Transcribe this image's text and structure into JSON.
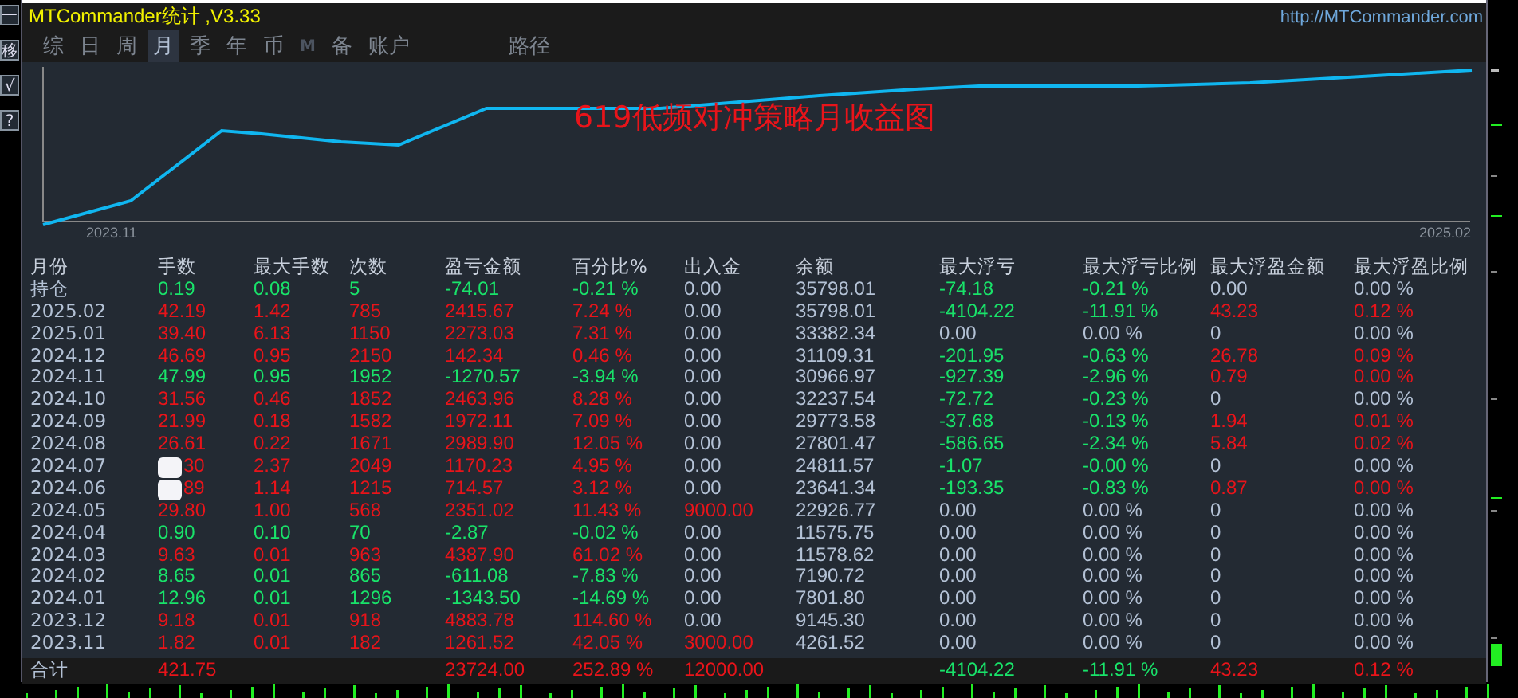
{
  "side_buttons": [
    "一",
    "移",
    "√",
    "?"
  ],
  "panel": {
    "title": "MTCommander统计 ,V3.33",
    "url": "http://MTCommander.com"
  },
  "tabs": [
    {
      "label": "综",
      "selected": false,
      "disabled": false
    },
    {
      "label": "日",
      "selected": false,
      "disabled": false
    },
    {
      "label": "周",
      "selected": false,
      "disabled": false
    },
    {
      "label": "月",
      "selected": true,
      "disabled": false
    },
    {
      "label": "季",
      "selected": false,
      "disabled": false
    },
    {
      "label": "年",
      "selected": false,
      "disabled": false
    },
    {
      "label": "币",
      "selected": false,
      "disabled": false
    },
    {
      "label": "M",
      "selected": false,
      "disabled": true
    },
    {
      "label": "备",
      "selected": false,
      "disabled": false
    },
    {
      "label": "账户",
      "selected": false,
      "disabled": false
    }
  ],
  "path_tab": {
    "label": "路径"
  },
  "chart": {
    "title": "619低频对冲策略月收益图",
    "x_start_label": "2023.11",
    "x_end_label": "2025.02"
  },
  "table": {
    "columns": [
      "月份",
      "手数",
      "最大手数",
      "次数",
      "盈亏金额",
      "百分比%",
      "出入金",
      "余额",
      "最大浮亏",
      "最大浮亏比例",
      "最大浮盈金额",
      "最大浮盈比例"
    ],
    "rows": [
      {
        "cells": [
          {
            "text": "持仓",
            "color": "#b4c2d6"
          },
          {
            "text": "0.19",
            "color": "#19e36a"
          },
          {
            "text": "0.08",
            "color": "#19e36a"
          },
          {
            "text": "5",
            "color": "#19e36a"
          },
          {
            "text": "-74.01",
            "color": "#19e36a"
          },
          {
            "text": "-0.21 %",
            "color": "#19e36a"
          },
          {
            "text": "0.00",
            "color": "#b4c2d6"
          },
          {
            "text": "35798.01",
            "color": "#b4c2d6"
          },
          {
            "text": "-74.18",
            "color": "#19e36a"
          },
          {
            "text": "-0.21 %",
            "color": "#19e36a"
          },
          {
            "text": "0.00",
            "color": "#b4c2d6"
          },
          {
            "text": "0.00 %",
            "color": "#b4c2d6"
          }
        ]
      },
      {
        "cells": [
          {
            "text": "2025.02",
            "color": "#b4c2d6"
          },
          {
            "text": "42.19",
            "color": "#e8141a"
          },
          {
            "text": "1.42",
            "color": "#e8141a"
          },
          {
            "text": "785",
            "color": "#e8141a"
          },
          {
            "text": "2415.67",
            "color": "#e8141a"
          },
          {
            "text": "7.24 %",
            "color": "#e8141a"
          },
          {
            "text": "0.00",
            "color": "#b4c2d6"
          },
          {
            "text": "35798.01",
            "color": "#b4c2d6"
          },
          {
            "text": "-4104.22",
            "color": "#19e36a"
          },
          {
            "text": "-11.91 %",
            "color": "#19e36a"
          },
          {
            "text": "43.23",
            "color": "#e8141a"
          },
          {
            "text": "0.12 %",
            "color": "#e8141a"
          }
        ]
      },
      {
        "cells": [
          {
            "text": "2025.01",
            "color": "#b4c2d6"
          },
          {
            "text": "39.40",
            "color": "#e8141a"
          },
          {
            "text": "6.13",
            "color": "#e8141a"
          },
          {
            "text": "1150",
            "color": "#e8141a"
          },
          {
            "text": "2273.03",
            "color": "#e8141a"
          },
          {
            "text": "7.31 %",
            "color": "#e8141a"
          },
          {
            "text": "0.00",
            "color": "#b4c2d6"
          },
          {
            "text": "33382.34",
            "color": "#b4c2d6"
          },
          {
            "text": "0.00",
            "color": "#b4c2d6"
          },
          {
            "text": "0.00 %",
            "color": "#b4c2d6"
          },
          {
            "text": "0",
            "color": "#b4c2d6"
          },
          {
            "text": "0.00 %",
            "color": "#b4c2d6"
          }
        ]
      },
      {
        "cells": [
          {
            "text": "2024.12",
            "color": "#b4c2d6"
          },
          {
            "text": "46.69",
            "color": "#e8141a"
          },
          {
            "text": "0.95",
            "color": "#e8141a"
          },
          {
            "text": "2150",
            "color": "#e8141a"
          },
          {
            "text": "142.34",
            "color": "#e8141a"
          },
          {
            "text": "0.46 %",
            "color": "#e8141a"
          },
          {
            "text": "0.00",
            "color": "#b4c2d6"
          },
          {
            "text": "31109.31",
            "color": "#b4c2d6"
          },
          {
            "text": "-201.95",
            "color": "#19e36a"
          },
          {
            "text": "-0.63 %",
            "color": "#19e36a"
          },
          {
            "text": "26.78",
            "color": "#e8141a"
          },
          {
            "text": "0.09 %",
            "color": "#e8141a"
          }
        ]
      },
      {
        "cells": [
          {
            "text": "2024.11",
            "color": "#b4c2d6"
          },
          {
            "text": "47.99",
            "color": "#19e36a"
          },
          {
            "text": "0.95",
            "color": "#19e36a"
          },
          {
            "text": "1952",
            "color": "#19e36a"
          },
          {
            "text": "-1270.57",
            "color": "#19e36a"
          },
          {
            "text": "-3.94 %",
            "color": "#19e36a"
          },
          {
            "text": "0.00",
            "color": "#b4c2d6"
          },
          {
            "text": "30966.97",
            "color": "#b4c2d6"
          },
          {
            "text": "-927.39",
            "color": "#19e36a"
          },
          {
            "text": "-2.96 %",
            "color": "#19e36a"
          },
          {
            "text": "0.79",
            "color": "#e8141a"
          },
          {
            "text": "0.00 %",
            "color": "#e8141a"
          }
        ]
      },
      {
        "cells": [
          {
            "text": "2024.10",
            "color": "#b4c2d6"
          },
          {
            "text": "31.56",
            "color": "#e8141a"
          },
          {
            "text": "0.46",
            "color": "#e8141a"
          },
          {
            "text": "1852",
            "color": "#e8141a"
          },
          {
            "text": "2463.96",
            "color": "#e8141a"
          },
          {
            "text": "8.28 %",
            "color": "#e8141a"
          },
          {
            "text": "0.00",
            "color": "#b4c2d6"
          },
          {
            "text": "32237.54",
            "color": "#b4c2d6"
          },
          {
            "text": "-72.72",
            "color": "#19e36a"
          },
          {
            "text": "-0.23 %",
            "color": "#19e36a"
          },
          {
            "text": "0",
            "color": "#b4c2d6"
          },
          {
            "text": "0.00 %",
            "color": "#b4c2d6"
          }
        ]
      },
      {
        "cells": [
          {
            "text": "2024.09",
            "color": "#b4c2d6"
          },
          {
            "text": "21.99",
            "color": "#e8141a"
          },
          {
            "text": "0.18",
            "color": "#e8141a"
          },
          {
            "text": "1582",
            "color": "#e8141a"
          },
          {
            "text": "1972.11",
            "color": "#e8141a"
          },
          {
            "text": "7.09 %",
            "color": "#e8141a"
          },
          {
            "text": "0.00",
            "color": "#b4c2d6"
          },
          {
            "text": "29773.58",
            "color": "#b4c2d6"
          },
          {
            "text": "-37.68",
            "color": "#19e36a"
          },
          {
            "text": "-0.13 %",
            "color": "#19e36a"
          },
          {
            "text": "1.94",
            "color": "#e8141a"
          },
          {
            "text": "0.01 %",
            "color": "#e8141a"
          }
        ]
      },
      {
        "cells": [
          {
            "text": "2024.08",
            "color": "#b4c2d6"
          },
          {
            "text": "26.61",
            "color": "#e8141a"
          },
          {
            "text": "0.22",
            "color": "#e8141a"
          },
          {
            "text": "1671",
            "color": "#e8141a"
          },
          {
            "text": "2989.90",
            "color": "#e8141a"
          },
          {
            "text": "12.05 %",
            "color": "#e8141a"
          },
          {
            "text": "0.00",
            "color": "#b4c2d6"
          },
          {
            "text": "27801.47",
            "color": "#b4c2d6"
          },
          {
            "text": "-586.65",
            "color": "#19e36a"
          },
          {
            "text": "-2.34 %",
            "color": "#19e36a"
          },
          {
            "text": "5.84",
            "color": "#e8141a"
          },
          {
            "text": "0.02 %",
            "color": "#e8141a"
          }
        ]
      },
      {
        "cells": [
          {
            "text": "2024.07",
            "color": "#b4c2d6"
          },
          {
            "text": "30",
            "color": "#e8141a",
            "covered": true
          },
          {
            "text": "2.37",
            "color": "#e8141a"
          },
          {
            "text": "2049",
            "color": "#e8141a"
          },
          {
            "text": "1170.23",
            "color": "#e8141a"
          },
          {
            "text": "4.95 %",
            "color": "#e8141a"
          },
          {
            "text": "0.00",
            "color": "#b4c2d6"
          },
          {
            "text": "24811.57",
            "color": "#b4c2d6"
          },
          {
            "text": "-1.07",
            "color": "#19e36a"
          },
          {
            "text": "-0.00 %",
            "color": "#19e36a"
          },
          {
            "text": "0",
            "color": "#b4c2d6"
          },
          {
            "text": "0.00 %",
            "color": "#b4c2d6"
          }
        ]
      },
      {
        "cells": [
          {
            "text": "2024.06",
            "color": "#b4c2d6"
          },
          {
            "text": "89",
            "color": "#e8141a",
            "covered": true
          },
          {
            "text": "1.14",
            "color": "#e8141a"
          },
          {
            "text": "1215",
            "color": "#e8141a"
          },
          {
            "text": "714.57",
            "color": "#e8141a"
          },
          {
            "text": "3.12 %",
            "color": "#e8141a"
          },
          {
            "text": "0.00",
            "color": "#b4c2d6"
          },
          {
            "text": "23641.34",
            "color": "#b4c2d6"
          },
          {
            "text": "-193.35",
            "color": "#19e36a"
          },
          {
            "text": "-0.83 %",
            "color": "#19e36a"
          },
          {
            "text": "0.87",
            "color": "#e8141a"
          },
          {
            "text": "0.00 %",
            "color": "#e8141a"
          }
        ]
      },
      {
        "cells": [
          {
            "text": "2024.05",
            "color": "#b4c2d6"
          },
          {
            "text": "29.80",
            "color": "#e8141a"
          },
          {
            "text": "1.00",
            "color": "#e8141a"
          },
          {
            "text": "568",
            "color": "#e8141a"
          },
          {
            "text": "2351.02",
            "color": "#e8141a"
          },
          {
            "text": "11.43 %",
            "color": "#e8141a"
          },
          {
            "text": "9000.00",
            "color": "#e8141a"
          },
          {
            "text": "22926.77",
            "color": "#b4c2d6"
          },
          {
            "text": "0.00",
            "color": "#b4c2d6"
          },
          {
            "text": "0.00 %",
            "color": "#b4c2d6"
          },
          {
            "text": "0",
            "color": "#b4c2d6"
          },
          {
            "text": "0.00 %",
            "color": "#b4c2d6"
          }
        ]
      },
      {
        "cells": [
          {
            "text": "2024.04",
            "color": "#b4c2d6"
          },
          {
            "text": "0.90",
            "color": "#19e36a"
          },
          {
            "text": "0.10",
            "color": "#19e36a"
          },
          {
            "text": "70",
            "color": "#19e36a"
          },
          {
            "text": "-2.87",
            "color": "#19e36a"
          },
          {
            "text": "-0.02 %",
            "color": "#19e36a"
          },
          {
            "text": "0.00",
            "color": "#b4c2d6"
          },
          {
            "text": "11575.75",
            "color": "#b4c2d6"
          },
          {
            "text": "0.00",
            "color": "#b4c2d6"
          },
          {
            "text": "0.00 %",
            "color": "#b4c2d6"
          },
          {
            "text": "0",
            "color": "#b4c2d6"
          },
          {
            "text": "0.00 %",
            "color": "#b4c2d6"
          }
        ]
      },
      {
        "cells": [
          {
            "text": "2024.03",
            "color": "#b4c2d6"
          },
          {
            "text": "9.63",
            "color": "#e8141a"
          },
          {
            "text": "0.01",
            "color": "#e8141a"
          },
          {
            "text": "963",
            "color": "#e8141a"
          },
          {
            "text": "4387.90",
            "color": "#e8141a"
          },
          {
            "text": "61.02 %",
            "color": "#e8141a"
          },
          {
            "text": "0.00",
            "color": "#b4c2d6"
          },
          {
            "text": "11578.62",
            "color": "#b4c2d6"
          },
          {
            "text": "0.00",
            "color": "#b4c2d6"
          },
          {
            "text": "0.00 %",
            "color": "#b4c2d6"
          },
          {
            "text": "0",
            "color": "#b4c2d6"
          },
          {
            "text": "0.00 %",
            "color": "#b4c2d6"
          }
        ]
      },
      {
        "cells": [
          {
            "text": "2024.02",
            "color": "#b4c2d6"
          },
          {
            "text": "8.65",
            "color": "#19e36a"
          },
          {
            "text": "0.01",
            "color": "#19e36a"
          },
          {
            "text": "865",
            "color": "#19e36a"
          },
          {
            "text": "-611.08",
            "color": "#19e36a"
          },
          {
            "text": "-7.83 %",
            "color": "#19e36a"
          },
          {
            "text": "0.00",
            "color": "#b4c2d6"
          },
          {
            "text": "7190.72",
            "color": "#b4c2d6"
          },
          {
            "text": "0.00",
            "color": "#b4c2d6"
          },
          {
            "text": "0.00 %",
            "color": "#b4c2d6"
          },
          {
            "text": "0",
            "color": "#b4c2d6"
          },
          {
            "text": "0.00 %",
            "color": "#b4c2d6"
          }
        ]
      },
      {
        "cells": [
          {
            "text": "2024.01",
            "color": "#b4c2d6"
          },
          {
            "text": "12.96",
            "color": "#19e36a"
          },
          {
            "text": "0.01",
            "color": "#19e36a"
          },
          {
            "text": "1296",
            "color": "#19e36a"
          },
          {
            "text": "-1343.50",
            "color": "#19e36a"
          },
          {
            "text": "-14.69 %",
            "color": "#19e36a"
          },
          {
            "text": "0.00",
            "color": "#b4c2d6"
          },
          {
            "text": "7801.80",
            "color": "#b4c2d6"
          },
          {
            "text": "0.00",
            "color": "#b4c2d6"
          },
          {
            "text": "0.00 %",
            "color": "#b4c2d6"
          },
          {
            "text": "0",
            "color": "#b4c2d6"
          },
          {
            "text": "0.00 %",
            "color": "#b4c2d6"
          }
        ]
      },
      {
        "cells": [
          {
            "text": "2023.12",
            "color": "#b4c2d6"
          },
          {
            "text": "9.18",
            "color": "#e8141a"
          },
          {
            "text": "0.01",
            "color": "#e8141a"
          },
          {
            "text": "918",
            "color": "#e8141a"
          },
          {
            "text": "4883.78",
            "color": "#e8141a"
          },
          {
            "text": "114.60 %",
            "color": "#e8141a"
          },
          {
            "text": "0.00",
            "color": "#b4c2d6"
          },
          {
            "text": "9145.30",
            "color": "#b4c2d6"
          },
          {
            "text": "0.00",
            "color": "#b4c2d6"
          },
          {
            "text": "0.00 %",
            "color": "#b4c2d6"
          },
          {
            "text": "0",
            "color": "#b4c2d6"
          },
          {
            "text": "0.00 %",
            "color": "#b4c2d6"
          }
        ]
      },
      {
        "cells": [
          {
            "text": "2023.11",
            "color": "#b4c2d6"
          },
          {
            "text": "1.82",
            "color": "#e8141a"
          },
          {
            "text": "0.01",
            "color": "#e8141a"
          },
          {
            "text": "182",
            "color": "#e8141a"
          },
          {
            "text": "1261.52",
            "color": "#e8141a"
          },
          {
            "text": "42.05 %",
            "color": "#e8141a"
          },
          {
            "text": "3000.00",
            "color": "#e8141a"
          },
          {
            "text": "4261.52",
            "color": "#b4c2d6"
          },
          {
            "text": "0.00",
            "color": "#b4c2d6"
          },
          {
            "text": "0.00 %",
            "color": "#b4c2d6"
          },
          {
            "text": "0",
            "color": "#b4c2d6"
          },
          {
            "text": "0.00 %",
            "color": "#b4c2d6"
          }
        ]
      }
    ],
    "total_row": {
      "cells": [
        {
          "text": "合计",
          "color": "#b4c2d6"
        },
        {
          "text": "421.75",
          "color": "#e8141a"
        },
        {
          "text": ""
        },
        {
          "text": ""
        },
        {
          "text": "23724.00",
          "color": "#e8141a"
        },
        {
          "text": "252.89 %",
          "color": "#e8141a"
        },
        {
          "text": "12000.00",
          "color": "#e8141a"
        },
        {
          "text": ""
        },
        {
          "text": "-4104.22",
          "color": "#19e36a"
        },
        {
          "text": "-11.91 %",
          "color": "#19e36a"
        },
        {
          "text": "43.23",
          "color": "#e8141a"
        },
        {
          "text": "0.12 %",
          "color": "#e8141a"
        }
      ]
    }
  }
}
